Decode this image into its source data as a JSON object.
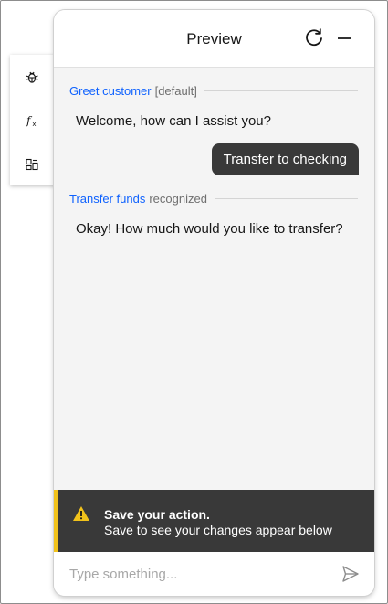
{
  "rail": {
    "items": [
      {
        "icon": "bug-icon"
      },
      {
        "icon": "function-icon"
      },
      {
        "icon": "variables-icon"
      }
    ]
  },
  "header": {
    "title": "Preview",
    "refresh_icon": "refresh-icon",
    "minimize_icon": "minimize-icon"
  },
  "conversation": {
    "greet": {
      "intent": "Greet customer",
      "tag": "[default]"
    },
    "bot_message_1": "Welcome, how can I assist you?",
    "user_message": "Transfer to checking",
    "transfer": {
      "intent": "Transfer funds",
      "tag": "recognized"
    },
    "bot_message_2": "Okay! How much would you like to transfer?"
  },
  "notice": {
    "title": "Save your action.",
    "body": "Save to see your changes appear below",
    "accent_color": "#f1c21b",
    "icon": "warning-icon"
  },
  "composer": {
    "placeholder": "Type something...",
    "value": "",
    "send_icon": "send-icon"
  },
  "colors": {
    "link_blue": "#0f62fe",
    "dark_surface": "#393939",
    "panel_bg": "#f4f4f4"
  }
}
